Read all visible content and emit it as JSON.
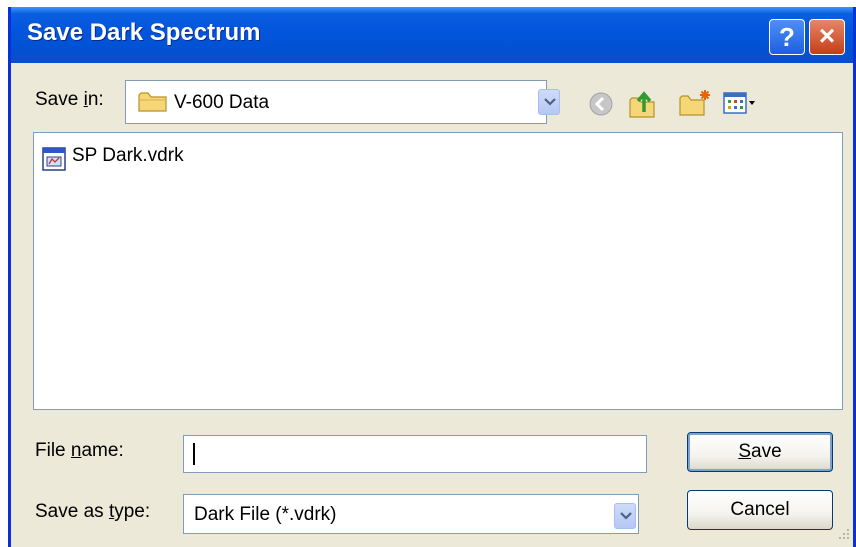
{
  "window": {
    "title": "Save Dark Spectrum"
  },
  "title_buttons": {
    "help": "?",
    "close": "×"
  },
  "save_in": {
    "label_prefix": "Save ",
    "label_accel": "i",
    "label_suffix": "n:",
    "current_folder": "V-600 Data",
    "folder_icon": "folder-icon"
  },
  "toolbar": {
    "icons": [
      "back-icon",
      "up-one-level-icon",
      "new-folder-icon",
      "views-menu-icon"
    ]
  },
  "files": [
    {
      "name": "SP Dark.vdrk",
      "icon": "vdrk-file-icon"
    }
  ],
  "file_name": {
    "label_prefix": "File ",
    "label_accel": "n",
    "label_suffix": "ame:",
    "value": ""
  },
  "save_as_type": {
    "label_prefix": "Save as ",
    "label_accel": "t",
    "label_suffix": "ype:",
    "selected": "Dark File (*.vdrk)"
  },
  "buttons": {
    "save_accel": "S",
    "save_rest": "ave",
    "cancel": "Cancel"
  },
  "colors": {
    "title_bar": "#0a5fe0",
    "window_face": "#ece9d8",
    "close_button": "#c53e16",
    "button_border": "#003c74"
  }
}
